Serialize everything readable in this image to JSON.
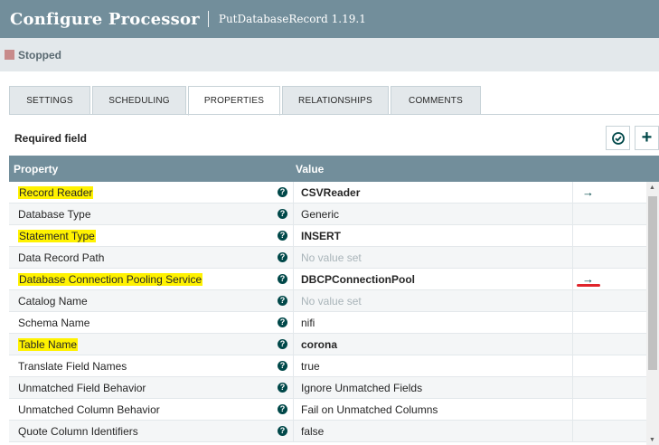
{
  "window": {
    "title": "Configure Processor",
    "subtitle": "PutDatabaseRecord 1.19.1"
  },
  "status": {
    "label": "Stopped",
    "color": "#c88b8b"
  },
  "tabs": [
    {
      "label": "SETTINGS",
      "active": false
    },
    {
      "label": "SCHEDULING",
      "active": false
    },
    {
      "label": "PROPERTIES",
      "active": true
    },
    {
      "label": "RELATIONSHIPS",
      "active": false
    },
    {
      "label": "COMMENTS",
      "active": false
    }
  ],
  "toolbar": {
    "required_label": "Required field",
    "verify_icon": "check-circle-icon",
    "add_icon": "plus-icon",
    "add_symbol": "+"
  },
  "table": {
    "header_property": "Property",
    "header_value": "Value",
    "rows": [
      {
        "property": "Record Reader",
        "value": "CSVReader",
        "required": true,
        "set": true,
        "arrow": "→",
        "annotated": false
      },
      {
        "property": "Database Type",
        "value": "Generic",
        "required": false,
        "set": true,
        "arrow": "",
        "annotated": false
      },
      {
        "property": "Statement Type",
        "value": "INSERT",
        "required": true,
        "set": true,
        "arrow": "",
        "annotated": false
      },
      {
        "property": "Data Record Path",
        "value": "No value set",
        "required": false,
        "set": false,
        "arrow": "",
        "annotated": false
      },
      {
        "property": "Database Connection Pooling Service",
        "value": "DBCPConnectionPool",
        "required": true,
        "set": true,
        "arrow": "→",
        "annotated": true
      },
      {
        "property": "Catalog Name",
        "value": "No value set",
        "required": false,
        "set": false,
        "arrow": "",
        "annotated": false
      },
      {
        "property": "Schema Name",
        "value": "nifi",
        "required": false,
        "set": true,
        "arrow": "",
        "annotated": false
      },
      {
        "property": "Table Name",
        "value": "corona",
        "required": true,
        "set": true,
        "arrow": "",
        "annotated": false
      },
      {
        "property": "Translate Field Names",
        "value": "true",
        "required": false,
        "set": true,
        "arrow": "",
        "annotated": false
      },
      {
        "property": "Unmatched Field Behavior",
        "value": "Ignore Unmatched Fields",
        "required": false,
        "set": true,
        "arrow": "",
        "annotated": false
      },
      {
        "property": "Unmatched Column Behavior",
        "value": "Fail on Unmatched Columns",
        "required": false,
        "set": true,
        "arrow": "",
        "annotated": false
      },
      {
        "property": "Quote Column Identifiers",
        "value": "false",
        "required": false,
        "set": true,
        "arrow": "",
        "annotated": false
      }
    ]
  },
  "colors": {
    "header": "#728e9b",
    "accent": "#004849",
    "highlight": "#fff200",
    "annotation": "#e0242b"
  }
}
